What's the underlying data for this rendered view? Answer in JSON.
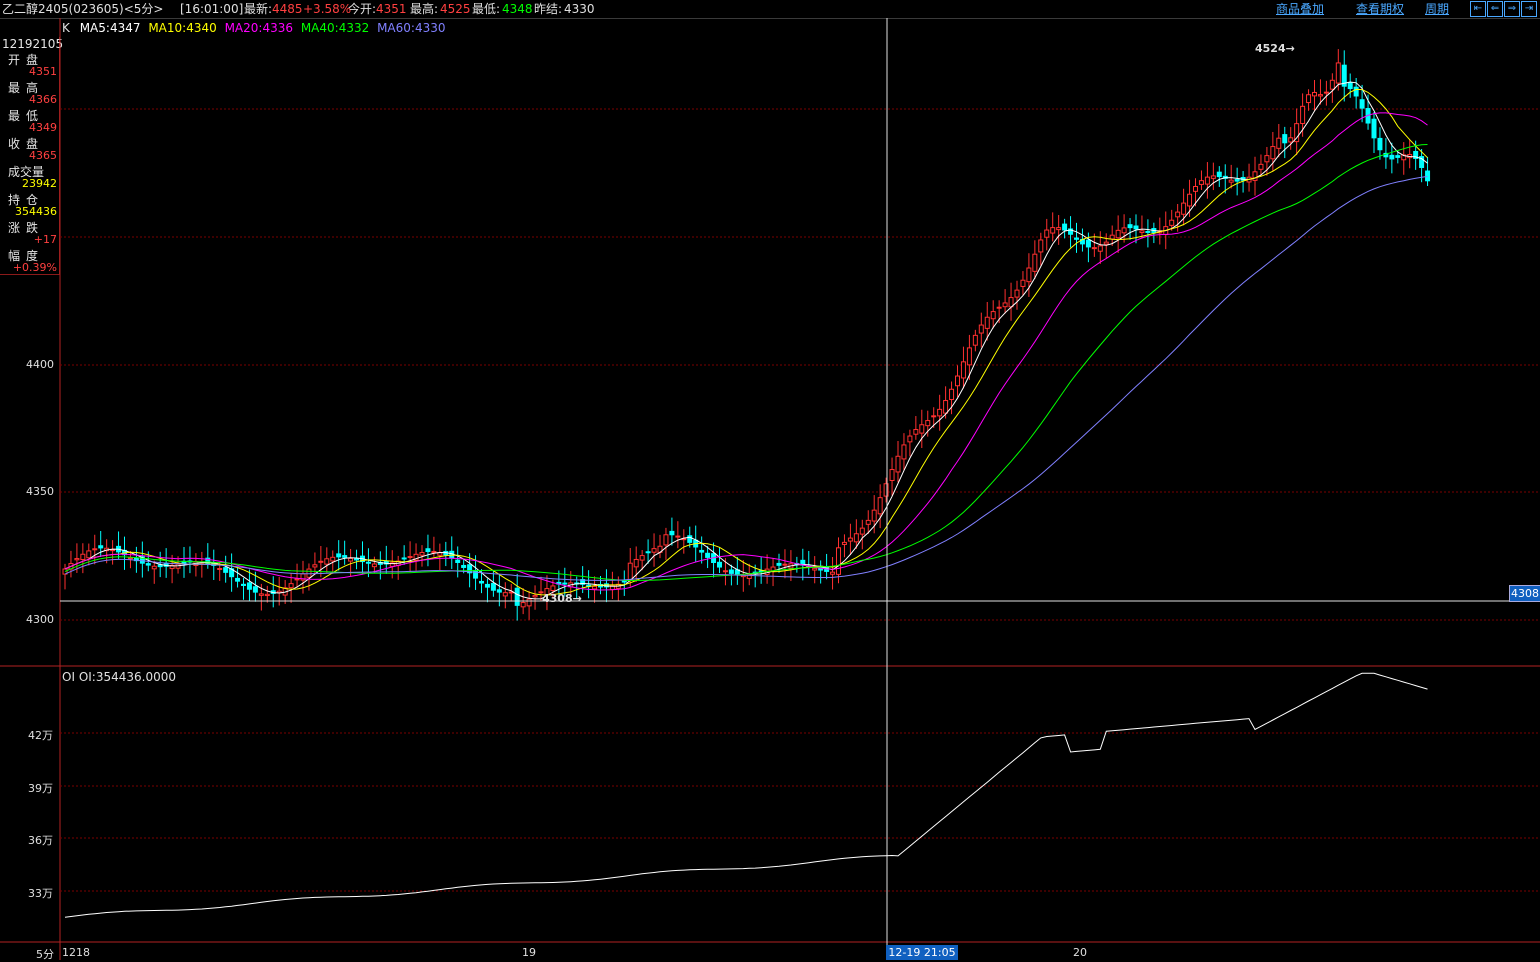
{
  "header": {
    "symbol": "乙二醇2405(023605)<5分>",
    "time": "[16:01:00]",
    "latest_label": "最新:",
    "latest": "4485",
    "change_pct": "+3.58%",
    "open_label": "今开:",
    "open": "4351",
    "high_label": "最高:",
    "high": "4525",
    "low_label": "最低:",
    "low": "4348",
    "prev_settle_label": "昨结:",
    "prev_settle": "4330",
    "menu": [
      "商品叠加",
      "查看期权",
      "周期"
    ],
    "nav_icons": [
      "arrow-left-end-icon",
      "arrow-left-icon",
      "arrow-right-icon",
      "arrow-right-end-icon"
    ]
  },
  "indicator": {
    "k_label": "K",
    "ma5": "MA5:4347",
    "ma10": "MA10:4340",
    "ma20": "MA20:4336",
    "ma40": "MA40:4332",
    "ma60": "MA60:4330",
    "colors": {
      "ma5": "#ffffff",
      "ma10": "#ffff00",
      "ma20": "#ff00ff",
      "ma40": "#00ff00",
      "ma60": "#8080ff"
    }
  },
  "info_panel": {
    "date": "12192105",
    "rows": [
      {
        "label": "开盘",
        "value": "4351",
        "color": "#ff4040"
      },
      {
        "label": "最高",
        "value": "4366",
        "color": "#ff4040"
      },
      {
        "label": "最低",
        "value": "4349",
        "color": "#ff4040"
      },
      {
        "label": "收盘",
        "value": "4365",
        "color": "#ff4040"
      },
      {
        "label": "成交量",
        "value": "23942",
        "color": "#ffff00"
      },
      {
        "label": "持仓",
        "value": "354436",
        "color": "#ffff00"
      },
      {
        "label": "涨跌",
        "value": "+17",
        "color": "#ff4040"
      },
      {
        "label": "幅度",
        "value": "+0.39%",
        "color": "#ff4040"
      }
    ]
  },
  "price_axis": {
    "ticks": [
      "4400",
      "4350",
      "4300"
    ],
    "marker_low": "4308",
    "marker_high": "4524",
    "cursor_value": "4308"
  },
  "oi": {
    "label": "OI",
    "value_label": "OI:354436.0000",
    "ticks": [
      "42万",
      "39万",
      "36万",
      "33万"
    ]
  },
  "time_axis": {
    "period": "5分",
    "labels": [
      "1218",
      "19",
      "20"
    ],
    "cursor_time": "12-19 21:05"
  },
  "colors": {
    "up": "#ff3030",
    "down": "#00ffff",
    "grid": "#7a0000",
    "frame": "#b22222"
  }
}
